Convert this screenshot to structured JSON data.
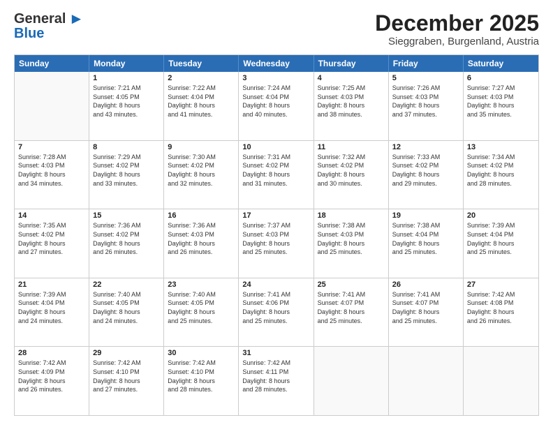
{
  "logo": {
    "line1": "General",
    "line2": "Blue"
  },
  "header": {
    "month": "December 2025",
    "location": "Sieggraben, Burgenland, Austria"
  },
  "weekdays": [
    "Sunday",
    "Monday",
    "Tuesday",
    "Wednesday",
    "Thursday",
    "Friday",
    "Saturday"
  ],
  "weeks": [
    [
      {
        "day": "",
        "lines": []
      },
      {
        "day": "1",
        "lines": [
          "Sunrise: 7:21 AM",
          "Sunset: 4:05 PM",
          "Daylight: 8 hours",
          "and 43 minutes."
        ]
      },
      {
        "day": "2",
        "lines": [
          "Sunrise: 7:22 AM",
          "Sunset: 4:04 PM",
          "Daylight: 8 hours",
          "and 41 minutes."
        ]
      },
      {
        "day": "3",
        "lines": [
          "Sunrise: 7:24 AM",
          "Sunset: 4:04 PM",
          "Daylight: 8 hours",
          "and 40 minutes."
        ]
      },
      {
        "day": "4",
        "lines": [
          "Sunrise: 7:25 AM",
          "Sunset: 4:03 PM",
          "Daylight: 8 hours",
          "and 38 minutes."
        ]
      },
      {
        "day": "5",
        "lines": [
          "Sunrise: 7:26 AM",
          "Sunset: 4:03 PM",
          "Daylight: 8 hours",
          "and 37 minutes."
        ]
      },
      {
        "day": "6",
        "lines": [
          "Sunrise: 7:27 AM",
          "Sunset: 4:03 PM",
          "Daylight: 8 hours",
          "and 35 minutes."
        ]
      }
    ],
    [
      {
        "day": "7",
        "lines": [
          "Sunrise: 7:28 AM",
          "Sunset: 4:03 PM",
          "Daylight: 8 hours",
          "and 34 minutes."
        ]
      },
      {
        "day": "8",
        "lines": [
          "Sunrise: 7:29 AM",
          "Sunset: 4:02 PM",
          "Daylight: 8 hours",
          "and 33 minutes."
        ]
      },
      {
        "day": "9",
        "lines": [
          "Sunrise: 7:30 AM",
          "Sunset: 4:02 PM",
          "Daylight: 8 hours",
          "and 32 minutes."
        ]
      },
      {
        "day": "10",
        "lines": [
          "Sunrise: 7:31 AM",
          "Sunset: 4:02 PM",
          "Daylight: 8 hours",
          "and 31 minutes."
        ]
      },
      {
        "day": "11",
        "lines": [
          "Sunrise: 7:32 AM",
          "Sunset: 4:02 PM",
          "Daylight: 8 hours",
          "and 30 minutes."
        ]
      },
      {
        "day": "12",
        "lines": [
          "Sunrise: 7:33 AM",
          "Sunset: 4:02 PM",
          "Daylight: 8 hours",
          "and 29 minutes."
        ]
      },
      {
        "day": "13",
        "lines": [
          "Sunrise: 7:34 AM",
          "Sunset: 4:02 PM",
          "Daylight: 8 hours",
          "and 28 minutes."
        ]
      }
    ],
    [
      {
        "day": "14",
        "lines": [
          "Sunrise: 7:35 AM",
          "Sunset: 4:02 PM",
          "Daylight: 8 hours",
          "and 27 minutes."
        ]
      },
      {
        "day": "15",
        "lines": [
          "Sunrise: 7:36 AM",
          "Sunset: 4:02 PM",
          "Daylight: 8 hours",
          "and 26 minutes."
        ]
      },
      {
        "day": "16",
        "lines": [
          "Sunrise: 7:36 AM",
          "Sunset: 4:03 PM",
          "Daylight: 8 hours",
          "and 26 minutes."
        ]
      },
      {
        "day": "17",
        "lines": [
          "Sunrise: 7:37 AM",
          "Sunset: 4:03 PM",
          "Daylight: 8 hours",
          "and 25 minutes."
        ]
      },
      {
        "day": "18",
        "lines": [
          "Sunrise: 7:38 AM",
          "Sunset: 4:03 PM",
          "Daylight: 8 hours",
          "and 25 minutes."
        ]
      },
      {
        "day": "19",
        "lines": [
          "Sunrise: 7:38 AM",
          "Sunset: 4:04 PM",
          "Daylight: 8 hours",
          "and 25 minutes."
        ]
      },
      {
        "day": "20",
        "lines": [
          "Sunrise: 7:39 AM",
          "Sunset: 4:04 PM",
          "Daylight: 8 hours",
          "and 25 minutes."
        ]
      }
    ],
    [
      {
        "day": "21",
        "lines": [
          "Sunrise: 7:39 AM",
          "Sunset: 4:04 PM",
          "Daylight: 8 hours",
          "and 24 minutes."
        ]
      },
      {
        "day": "22",
        "lines": [
          "Sunrise: 7:40 AM",
          "Sunset: 4:05 PM",
          "Daylight: 8 hours",
          "and 24 minutes."
        ]
      },
      {
        "day": "23",
        "lines": [
          "Sunrise: 7:40 AM",
          "Sunset: 4:05 PM",
          "Daylight: 8 hours",
          "and 25 minutes."
        ]
      },
      {
        "day": "24",
        "lines": [
          "Sunrise: 7:41 AM",
          "Sunset: 4:06 PM",
          "Daylight: 8 hours",
          "and 25 minutes."
        ]
      },
      {
        "day": "25",
        "lines": [
          "Sunrise: 7:41 AM",
          "Sunset: 4:07 PM",
          "Daylight: 8 hours",
          "and 25 minutes."
        ]
      },
      {
        "day": "26",
        "lines": [
          "Sunrise: 7:41 AM",
          "Sunset: 4:07 PM",
          "Daylight: 8 hours",
          "and 25 minutes."
        ]
      },
      {
        "day": "27",
        "lines": [
          "Sunrise: 7:42 AM",
          "Sunset: 4:08 PM",
          "Daylight: 8 hours",
          "and 26 minutes."
        ]
      }
    ],
    [
      {
        "day": "28",
        "lines": [
          "Sunrise: 7:42 AM",
          "Sunset: 4:09 PM",
          "Daylight: 8 hours",
          "and 26 minutes."
        ]
      },
      {
        "day": "29",
        "lines": [
          "Sunrise: 7:42 AM",
          "Sunset: 4:10 PM",
          "Daylight: 8 hours",
          "and 27 minutes."
        ]
      },
      {
        "day": "30",
        "lines": [
          "Sunrise: 7:42 AM",
          "Sunset: 4:10 PM",
          "Daylight: 8 hours",
          "and 28 minutes."
        ]
      },
      {
        "day": "31",
        "lines": [
          "Sunrise: 7:42 AM",
          "Sunset: 4:11 PM",
          "Daylight: 8 hours",
          "and 28 minutes."
        ]
      },
      {
        "day": "",
        "lines": []
      },
      {
        "day": "",
        "lines": []
      },
      {
        "day": "",
        "lines": []
      }
    ]
  ]
}
